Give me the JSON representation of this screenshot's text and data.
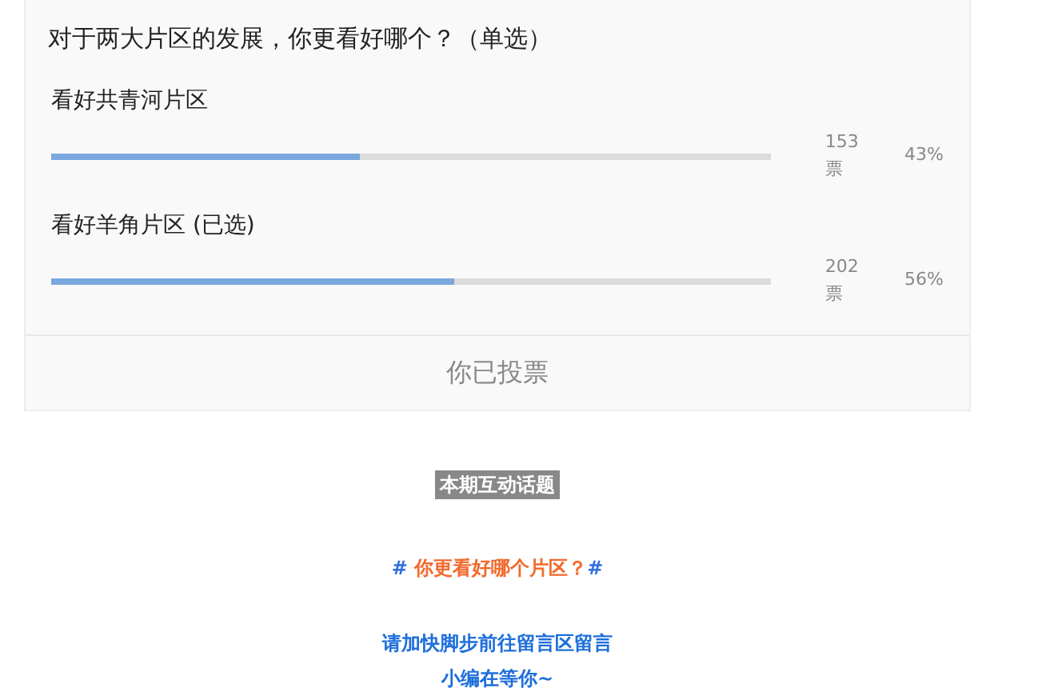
{
  "poll": {
    "question": "对于两大片区的发展，你更看好哪个？（单选）",
    "options": [
      {
        "label": "看好共青河片区",
        "level": 0.43,
        "votes": "153票",
        "percent": "43%"
      },
      {
        "label": "看好羊角片区 (已选)",
        "level": 0.56,
        "votes": "202票",
        "percent": "56%"
      }
    ],
    "footer": "你已投票"
  },
  "topic": {
    "tag": "本期互动话题",
    "prefix": "#",
    "title": "你更看好哪个片区？",
    "suffix": "#"
  },
  "invite": [
    "请加快脚步前往留言区留言",
    "小编在等你~"
  ]
}
